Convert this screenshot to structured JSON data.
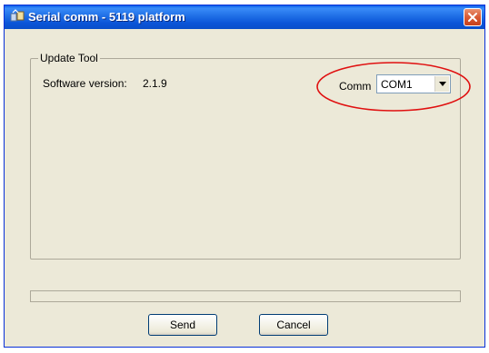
{
  "window": {
    "title": "Serial comm - 5119 platform"
  },
  "group": {
    "title": "Update Tool",
    "software_version_label": "Software version:",
    "software_version_value": "2.1.9",
    "comm_label": "Comm",
    "comm_selected": "COM1"
  },
  "buttons": {
    "send_label": "Send",
    "cancel_label": "Cancel"
  },
  "progress": {
    "value_percent": 0
  },
  "colors": {
    "titlebar": "#0b55d8",
    "dialog_bg": "#ece9d8",
    "close_button": "#d95a35",
    "highlight_ellipse": "#e01010"
  },
  "icons": {
    "app": "app-icon",
    "close": "close-icon",
    "dropdown": "chevron-down-icon"
  }
}
